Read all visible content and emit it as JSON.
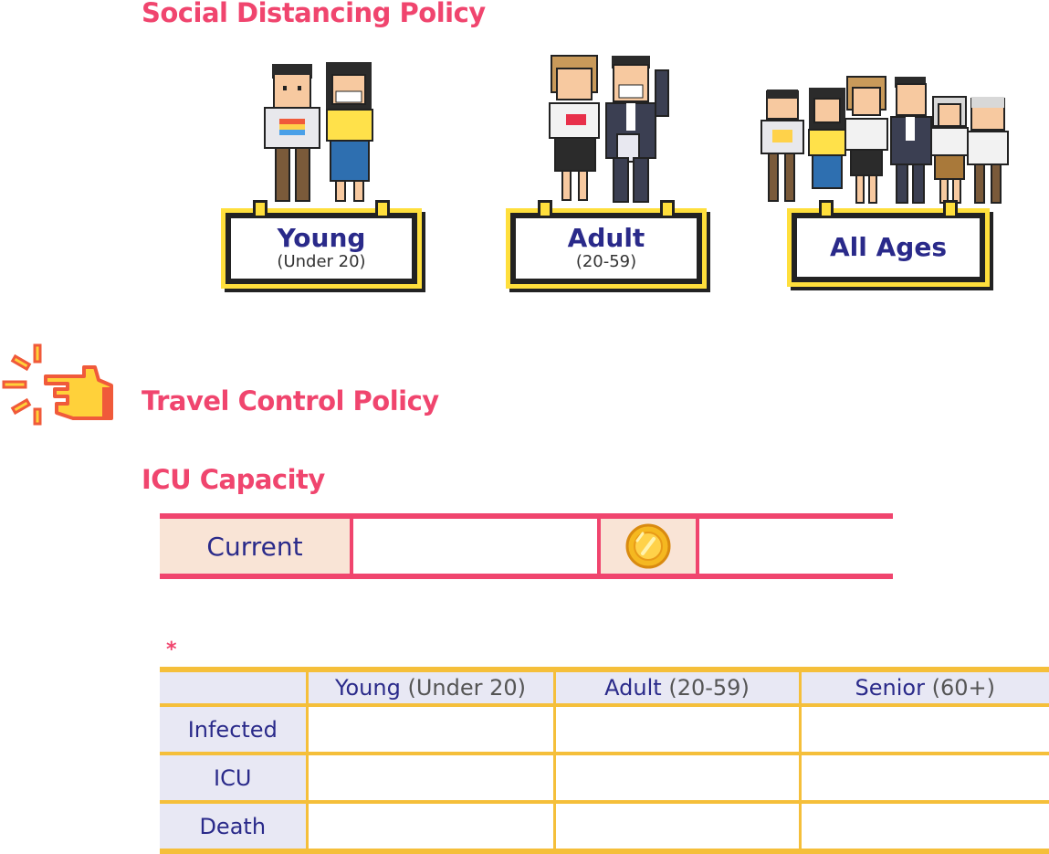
{
  "headings": {
    "social": "Social Distancing Policy",
    "travel": "Travel Control Policy",
    "icu": "ICU Capacity"
  },
  "groups": [
    {
      "title": "Young",
      "subtitle": "(Under 20)",
      "icon": "young-people-icon"
    },
    {
      "title": "Adult",
      "subtitle": "(20-59)",
      "icon": "adult-people-icon"
    },
    {
      "title": "All Ages",
      "subtitle": "",
      "icon": "all-ages-people-icon"
    }
  ],
  "capacity": {
    "label": "Current",
    "value": "",
    "coin_icon": "coin-icon",
    "extra": ""
  },
  "note_marker": "*",
  "stats": {
    "columns": [
      {
        "name": "Young",
        "range": "(Under 20)"
      },
      {
        "name": "Adult",
        "range": "(20-59)"
      },
      {
        "name": "Senior",
        "range": "(60+)"
      }
    ],
    "rows": [
      {
        "label": "Infected",
        "values": [
          "",
          "",
          ""
        ]
      },
      {
        "label": "ICU",
        "values": [
          "",
          "",
          ""
        ]
      },
      {
        "label": "Death",
        "values": [
          "",
          "",
          ""
        ]
      }
    ]
  },
  "colors": {
    "heading": "#f0456e",
    "label_text": "#2a2a8a",
    "capacity_border": "#f0456e",
    "table_border": "#f5bf3a",
    "sign_yellow": "#ffdf3c"
  }
}
